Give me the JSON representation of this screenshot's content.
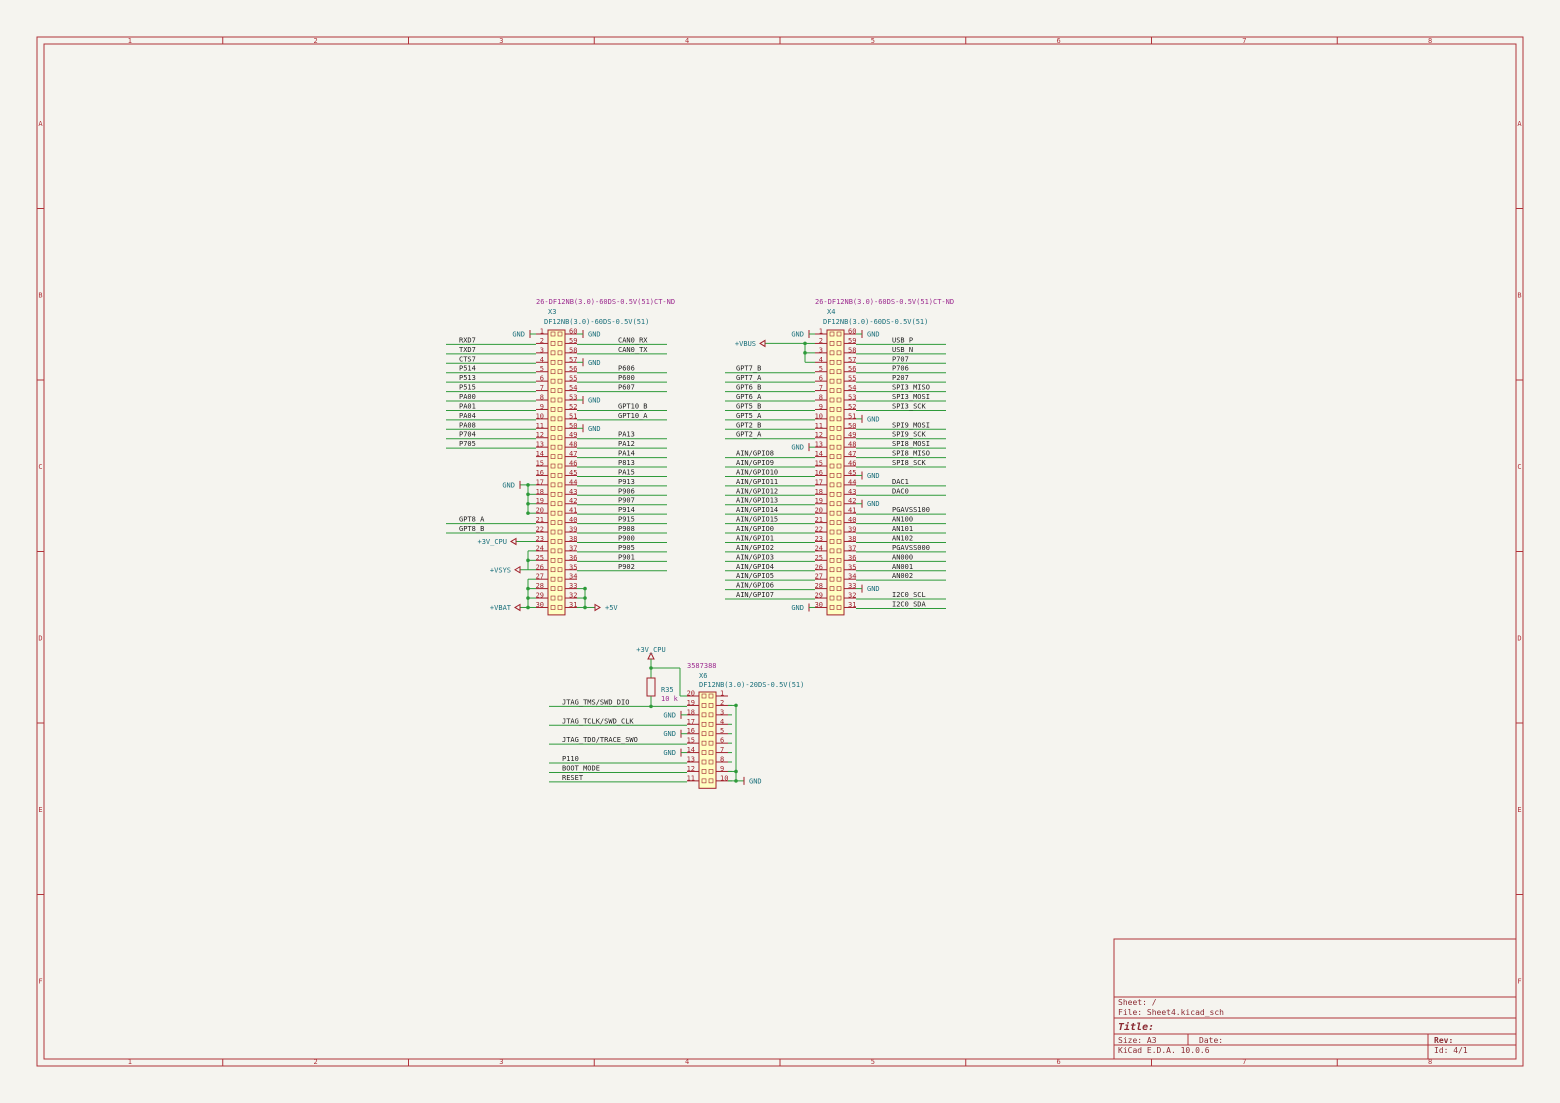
{
  "colors": {
    "background": "#f5f4ef",
    "frame": "#b0333a",
    "wire": "#2e9a3a",
    "pin": "#a0202a",
    "body_fill": "#ffffc2",
    "body_stroke": "#a0202a",
    "ref_text": "#1a6f7a",
    "value_text": "#9c2a8f",
    "power": "#a0202a",
    "power_text": "#1a6f7a",
    "label_text": "#1a1a1a",
    "junction": "#2e9a3a"
  },
  "frame": {
    "cols": [
      "1",
      "2",
      "3",
      "4",
      "5",
      "6",
      "7",
      "8"
    ],
    "rows": [
      "A",
      "B",
      "C",
      "D",
      "E",
      "F"
    ]
  },
  "title_block": {
    "sheet": "Sheet: /",
    "file": "File: Sheet4.kicad_sch",
    "title": "Title:",
    "size": "Size: A3",
    "date": "Date:",
    "rev": "Rev:",
    "tool": "KiCad E.D.A. 10.0.6",
    "id": "Id: 4/1"
  },
  "connectors": [
    {
      "ref": "X3",
      "value": "DF12NB(3.0)-60DS-0.5V(51)",
      "part": "26-DF12NB(3.0)-60DS-0.5V(51)CT-ND",
      "left_pins": [
        "1",
        "2",
        "3",
        "4",
        "5",
        "6",
        "7",
        "8",
        "9",
        "10",
        "11",
        "12",
        "13",
        "14",
        "15",
        "16",
        "17",
        "18",
        "19",
        "20",
        "21",
        "22",
        "23",
        "24",
        "25",
        "26",
        "27",
        "28",
        "29",
        "30"
      ],
      "right_pins": [
        "60",
        "59",
        "58",
        "57",
        "56",
        "55",
        "54",
        "53",
        "52",
        "51",
        "50",
        "49",
        "48",
        "47",
        "46",
        "45",
        "44",
        "43",
        "42",
        "41",
        "40",
        "39",
        "38",
        "37",
        "36",
        "35",
        "34",
        "33",
        "32",
        "31"
      ],
      "left_labels": [
        "",
        "RXD7",
        "TXD7",
        "CTS7",
        "P514",
        "P513",
        "P515",
        "PA00",
        "PA01",
        "PA04",
        "PA08",
        "P704",
        "P705",
        "",
        "",
        "",
        "",
        "",
        "",
        "",
        "GPT8_A",
        "GPT8_B",
        "",
        "",
        "",
        "",
        "",
        "",
        "",
        ""
      ],
      "right_labels": [
        "",
        "CAN0_RX",
        "CAN0_TX",
        "",
        "P606",
        "P600",
        "P607",
        "",
        "GPT10_B",
        "GPT10_A",
        "",
        "PA13",
        "PA12",
        "PA14",
        "P813",
        "PA15",
        "P913",
        "P906",
        "P907",
        "P914",
        "P915",
        "P908",
        "P900",
        "P905",
        "P901",
        "P902",
        "",
        "",
        "",
        ""
      ]
    },
    {
      "ref": "X4",
      "value": "DF12NB(3.0)-60DS-0.5V(51)",
      "part": "26-DF12NB(3.0)-60DS-0.5V(51)CT-ND",
      "left_pins": [
        "1",
        "2",
        "3",
        "4",
        "5",
        "6",
        "7",
        "8",
        "9",
        "10",
        "11",
        "12",
        "13",
        "14",
        "15",
        "16",
        "17",
        "18",
        "19",
        "20",
        "21",
        "22",
        "23",
        "24",
        "25",
        "26",
        "27",
        "28",
        "29",
        "30"
      ],
      "right_pins": [
        "60",
        "59",
        "58",
        "57",
        "56",
        "55",
        "54",
        "53",
        "52",
        "51",
        "50",
        "49",
        "48",
        "47",
        "46",
        "45",
        "44",
        "43",
        "42",
        "41",
        "40",
        "39",
        "38",
        "37",
        "36",
        "35",
        "34",
        "33",
        "32",
        "31"
      ],
      "left_labels": [
        "",
        "",
        "",
        "",
        "GPT7_B",
        "GPT7_A",
        "GPT6_B",
        "GPT6_A",
        "GPT5_B",
        "GPT5_A",
        "GPT2_B",
        "GPT2_A",
        "",
        "AIN/GPIO8",
        "AIN/GPIO9",
        "AIN/GPIO10",
        "AIN/GPIO11",
        "AIN/GPIO12",
        "AIN/GPIO13",
        "AIN/GPIO14",
        "AIN/GPIO15",
        "AIN/GPIO0",
        "AIN/GPIO1",
        "AIN/GPIO2",
        "AIN/GPIO3",
        "AIN/GPIO4",
        "AIN/GPIO5",
        "AIN/GPIO6",
        "AIN/GPIO7",
        ""
      ],
      "right_labels": [
        "",
        "USB_P",
        "USB_N",
        "P707",
        "P706",
        "P207",
        "SPI3_MISO",
        "SPI3_MOSI",
        "SPI3_SCK",
        "",
        "SPI9_MOSI",
        "SPI9_SCK",
        "SPI8_MOSI",
        "SPI8_MISO",
        "SPI8_SCK",
        "",
        "DAC1",
        "DAC0",
        "",
        "PGAVSS100",
        "AN100",
        "AN101",
        "AN102",
        "PGAVSS000",
        "AN000",
        "AN001",
        "AN002",
        "",
        "I2C0_SCL",
        "I2C0_SDA"
      ]
    },
    {
      "ref": "X6",
      "value": "DF12NB(3.0)-20DS-0.5V(51)",
      "part": "3587388",
      "left_pins": [
        "20",
        "19",
        "18",
        "17",
        "16",
        "15",
        "14",
        "13",
        "12",
        "11"
      ],
      "right_pins": [
        "1",
        "2",
        "3",
        "4",
        "5",
        "6",
        "7",
        "8",
        "9",
        "10"
      ],
      "left_labels": [
        "",
        "JTAG_TMS/SWD_DIO",
        "",
        "JTAG_TCLK/SWD_CLK",
        "",
        "JTAG_TDO/TRACE_SWO",
        "",
        "P110",
        "BOOT_MODE",
        "RESET"
      ],
      "right_labels": [
        "",
        "",
        "",
        "",
        "",
        "",
        "",
        "",
        "",
        ""
      ]
    }
  ],
  "resistor": {
    "ref": "R35",
    "value": "10 k"
  },
  "power_labels": {
    "gnd": "GND",
    "v3_cpu": "+3V_CPU",
    "vsys": "+VSYS",
    "vbat": "+VBAT",
    "v5": "+5V",
    "vbus": "+VBUS"
  }
}
